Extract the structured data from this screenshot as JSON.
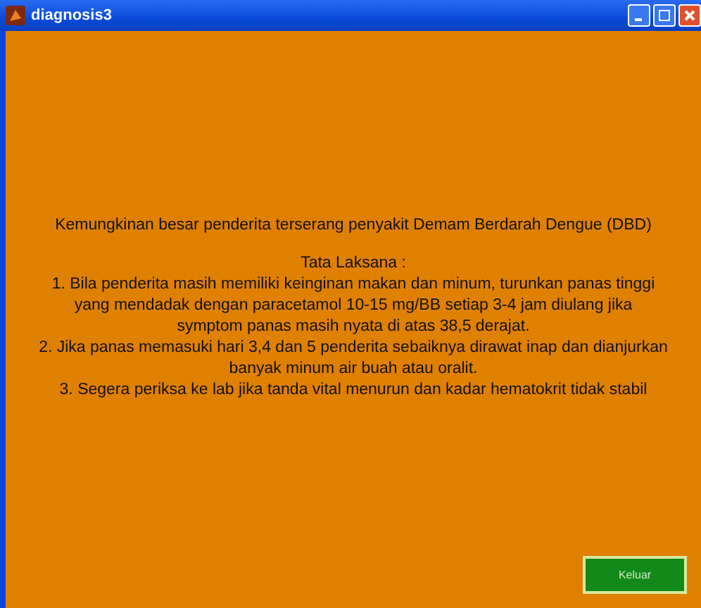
{
  "window": {
    "title": "diagnosis3"
  },
  "diagnosis": "Kemungkinan besar penderita terserang penyakit Demam Berdarah Dengue (DBD)",
  "treatment_heading": "Tata Laksana :",
  "treatment_items": [
    {
      "lines": [
        "1. Bila penderita masih memiliki keinginan makan dan minum, turunkan panas tinggi",
        "yang mendadak dengan paracetamol 10-15 mg/BB setiap 3-4 jam diulang jika",
        "symptom panas masih nyata di atas 38,5 derajat."
      ]
    },
    {
      "lines": [
        "2. Jika panas memasuki hari 3,4 dan 5 penderita sebaiknya dirawat inap dan dianjurkan",
        "banyak minum air buah atau oralit."
      ]
    },
    {
      "lines": [
        "3. Segera periksa ke lab jika tanda vital menurun dan kadar hematokrit tidak stabil"
      ]
    }
  ],
  "buttons": [
    {
      "label": "Keluar"
    }
  ]
}
